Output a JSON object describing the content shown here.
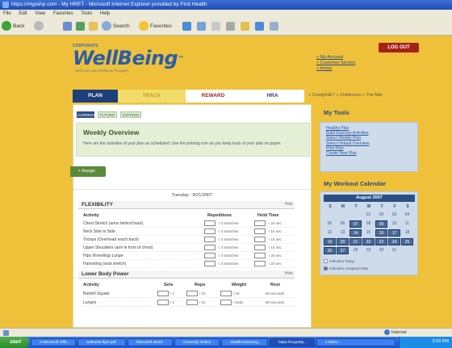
{
  "window": {
    "title": "https://mypshp.com - My HRET - Microsoft Internet Explorer provided by First Health"
  },
  "menubar": {
    "items": [
      "File",
      "Edit",
      "View",
      "Favorites",
      "Tools",
      "Help"
    ]
  },
  "toolbar": {
    "back": "Back",
    "search": "Search",
    "favorites": "Favorites"
  },
  "header": {
    "brand_small": "CORPORATE",
    "brand_name": "WellBeing",
    "brand_tm": "™",
    "tagline": "Self-Care and Wellness Program",
    "logout": "LOG OUT",
    "links": [
      "» My Account",
      "» Customer Service",
      "» Home"
    ]
  },
  "nav": {
    "tabs": [
      {
        "label": "PLAN",
        "bg": "#1f3f7a",
        "fg": "#ffffff"
      },
      {
        "label": "TRACK",
        "bg": "#f2dc6a",
        "fg": "#c79a20"
      },
      {
        "label": "REWARD",
        "bg": "#ffffff",
        "fg": "#9a2a22"
      },
      {
        "label": "HRA",
        "bg": "#ffffff",
        "fg": "#2a3f7a"
      }
    ],
    "breadcrumb": "» Comfy/HET  » Childrence  » The Met"
  },
  "plan_subtabs": [
    "CURRENT",
    "FUTURE",
    "EXPIRED"
  ],
  "overview": {
    "title": "Weekly Overview",
    "text": "Here are the activities of your plan as scheduled. Use the printing icon as you keep track of your plan on paper."
  },
  "assign_button": "+ Assign",
  "schedule": {
    "date": "Tuesday - 8/21/2007",
    "sections": [
      {
        "title": "FLEXIBILITY",
        "hide": "Hide",
        "columns": [
          "Activity",
          "Repetitions",
          "Hold Time"
        ],
        "rows": [
          {
            "activity": "Chest Stretch (arms behind back)",
            "reps": "/ 3 stretches",
            "hold": "/ 20 sec"
          },
          {
            "activity": "Neck Side to Side",
            "reps": "/ 3 stretches",
            "hold": "/ 15 sec"
          },
          {
            "activity": "Triceps (Overhead reach back)",
            "reps": "/ 3 stretches",
            "hold": "/ 15 sec"
          },
          {
            "activity": "Upper Shoulders (arm in front of chest)",
            "reps": "/ 3 stretches",
            "hold": "/ 15 sec"
          },
          {
            "activity": "Hips (Kneeling) Lunge",
            "reps": "/ 3 stretches",
            "hold": "/ 20 sec"
          },
          {
            "activity": "Hamstring (seat stretch)",
            "reps": "/ 3 stretches",
            "hold": "/ 20 sec"
          }
        ]
      },
      {
        "title": "Lower Body Power",
        "hide": "Hide",
        "columns": [
          "Activity",
          "Sets",
          "Reps",
          "Weight",
          "Rest"
        ],
        "rows": [
          {
            "activity": "Barbell Squats",
            "sets": "/ 1",
            "reps": "/ 10",
            "weight": "/ 20",
            "rest": "60 seconds"
          },
          {
            "activity": "Lunges",
            "sets": "/ 1",
            "reps": "/ 10",
            "weight": "/ body",
            "rest": "60 seconds"
          }
        ]
      }
    ]
  },
  "sidebar": {
    "tools_title": "My Tools",
    "tools": [
      "Healthy Plan",
      "Build Exercise Activities",
      "Select Weekly Plan",
      "Select Default Overview",
      "Print Plan",
      "Create New Plan"
    ],
    "calendar_title": "My Workout Calendar",
    "calendar": {
      "month": "August 2007",
      "weekdays": [
        "S",
        "M",
        "T",
        "W",
        "T",
        "F",
        "S"
      ],
      "weeks": [
        [
          "",
          "",
          "",
          "01",
          "02",
          "03",
          "04"
        ],
        [
          "05",
          "06",
          "07",
          "08",
          "09",
          "10",
          "11"
        ],
        [
          "12",
          "13",
          "14",
          "15",
          "16",
          "17",
          "18"
        ],
        [
          "19",
          "20",
          "21",
          "22",
          "23",
          "24",
          "25"
        ],
        [
          "26",
          "27",
          "28",
          "29",
          "30",
          "31",
          ""
        ]
      ],
      "active_days": [
        "07",
        "09",
        "14",
        "16",
        "17",
        "19",
        "20",
        "21",
        "22",
        "23",
        "24",
        "25",
        "26",
        "27"
      ]
    },
    "legend": [
      "Indicates Today",
      "Indicates Assigned Date"
    ]
  },
  "statusbar": {
    "zone": "Internet"
  },
  "taskbar": {
    "start": "start",
    "buttons": [
      "2 Microsoft Offic...",
      "wellness flyer.pdf",
      "Microsoft Word",
      "Coventry Online",
      "HealthAdvocacy...",
      "https://mypshp...",
      "2 Micro..."
    ],
    "clock": "3:03 PM"
  },
  "colors": {
    "page_bg": "#efc13a",
    "brand_blue": "#2a5ea8",
    "logout_red": "#a42218",
    "nav_active": "#1f3f7a",
    "sidebar_bg": "#cedbea"
  }
}
